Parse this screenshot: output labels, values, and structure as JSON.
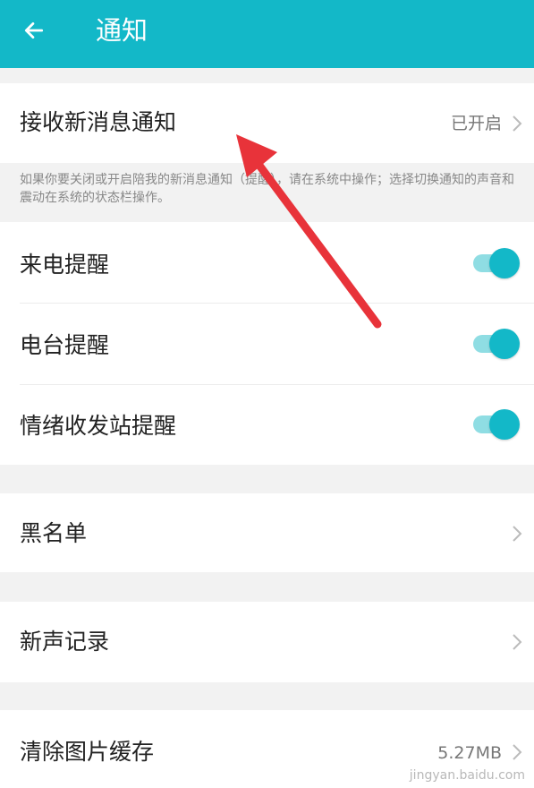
{
  "header": {
    "title": "通知",
    "back_icon": "arrow-left-icon",
    "background": "#13b8c8"
  },
  "settings": {
    "receive_notifications": {
      "label": "接收新消息通知",
      "value": "已开启"
    },
    "hint": "如果你要关闭或开启陪我的新消息通知（提醒），请在系统中操作；选择切换通知的声音和震动在系统的状态栏操作。",
    "toggles": [
      {
        "label": "来电提醒",
        "on": true
      },
      {
        "label": "电台提醒",
        "on": true
      },
      {
        "label": "情绪收发站提醒",
        "on": true
      }
    ],
    "blacklist": {
      "label": "黑名单"
    },
    "voice_records": {
      "label": "新声记录"
    },
    "clear_cache": {
      "label": "清除图片缓存",
      "value": "5.27MB"
    }
  },
  "colors": {
    "accent": "#13b8c8",
    "track": "#8fdde3",
    "annotation_arrow": "#e8333a"
  },
  "watermark": "jingyan.baidu.com"
}
